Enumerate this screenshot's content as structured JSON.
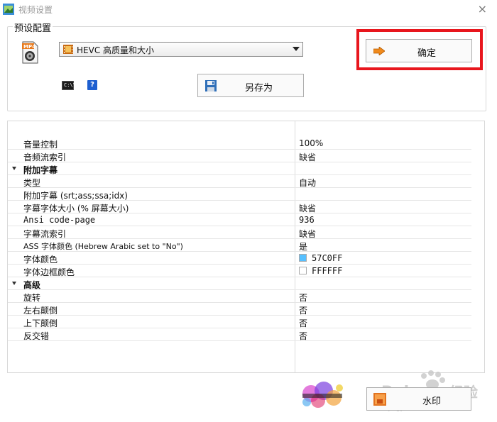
{
  "window": {
    "title": "视频设置",
    "close": "×"
  },
  "preset": {
    "legend": "预设配置",
    "selected": "HEVC 高质量和大小",
    "cmd_label": "C:\\\\",
    "help_label": "?",
    "save_as_label": "另存为",
    "ok_label": "确定",
    "highlight_color": "#e8161d"
  },
  "properties": {
    "rows": [
      {
        "type": "item",
        "name": "音量控制",
        "value": "100%"
      },
      {
        "type": "item",
        "name": "音频流索引",
        "value": "缺省"
      },
      {
        "type": "category",
        "name": "附加字幕",
        "value": ""
      },
      {
        "type": "item",
        "name": "类型",
        "value": "自动"
      },
      {
        "type": "item",
        "name": "附加字幕 (srt;ass;ssa;idx)",
        "value": ""
      },
      {
        "type": "item",
        "name": "字幕字体大小 (% 屏幕大小)",
        "value": "缺省"
      },
      {
        "type": "item",
        "name": "Ansi code-page",
        "value": "936"
      },
      {
        "type": "item",
        "name": "字幕流索引",
        "value": "缺省"
      },
      {
        "type": "item",
        "name": "ASS 字体颜色 (Hebrew Arabic set to \"No\")",
        "value": "是"
      },
      {
        "type": "color",
        "name": "字体颜色",
        "value": "57C0FF",
        "swatch": "#57C0FF"
      },
      {
        "type": "color",
        "name": "字体边框颜色",
        "value": "FFFFFF",
        "swatch": "#FFFFFF"
      },
      {
        "type": "category",
        "name": "高级",
        "value": ""
      },
      {
        "type": "item",
        "name": "旋转",
        "value": "否"
      },
      {
        "type": "item",
        "name": "左右颠倒",
        "value": "否"
      },
      {
        "type": "item",
        "name": "上下颠倒",
        "value": "否"
      },
      {
        "type": "item",
        "name": "反交错",
        "value": "否"
      }
    ]
  },
  "watermark": {
    "label": "水印"
  }
}
